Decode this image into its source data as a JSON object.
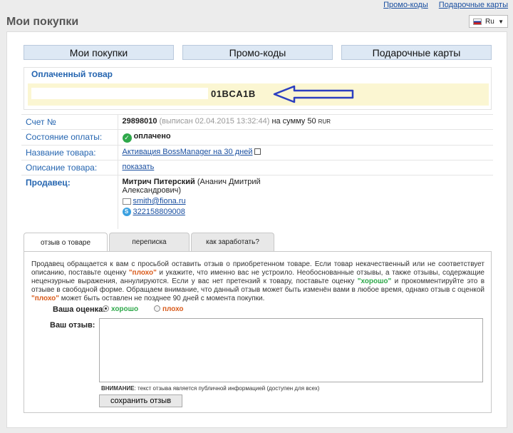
{
  "top_links": [
    "Промо-коды",
    "Подарочные карты"
  ],
  "page_title": "Мои покупки",
  "language": {
    "selected": "Ru"
  },
  "main_tabs": [
    "Мои покупки",
    "Промо-коды",
    "Подарочные карты"
  ],
  "paid_item": {
    "header": "Оплаченный товар",
    "code_suffix": "01BCA1B"
  },
  "info": {
    "invoice_label": "Счет №",
    "invoice_number": "29898010",
    "invoice_issued": "(выписан 02.04.2015 13:32:44)",
    "invoice_sum_prefix": "на сумму 50",
    "invoice_currency": "RUR",
    "payment_label": "Состояние оплаты:",
    "payment_status": "оплачено",
    "product_name_label": "Название товара:",
    "product_name": "Активация BossManager на 30 дней",
    "product_desc_label": "Описание товара:",
    "product_desc_link": "показать",
    "seller_label": "Продавец:",
    "seller_name": "Митрич Питерский",
    "seller_fullname": "(Ананич Дмитрий Александрович)",
    "seller_email": "smith@fiona.ru",
    "seller_skype": "322158809008"
  },
  "subtabs": [
    "отзыв о товаре",
    "переписка",
    "как заработать?"
  ],
  "review": {
    "desc_1": "Продавец обращается к вам с просьбой оставить отзыв о приобретенном товаре. Если товар некачественный или не соответствует описанию, поставьте оценку ",
    "bad_word": "\"плохо\"",
    "desc_2": " и укажите, что именно вас не устроило. Необоснованные отзывы, а также отзывы, содержащие нецензурные выражения, аннулируются. Если у вас нет претензий к товару, поставьте оценку ",
    "good_word": "\"хорошо\"",
    "desc_3": " и прокомментируйте это в отзыве в свободной форме. Обращаем внимание, что данный отзыв может быть изменён вами в любое время, однако отзыв с оценкой ",
    "bad_word_2": "\"плохо\"",
    "desc_4": " может быть оставлен не позднее 90 дней с момента покупки.",
    "rating_label": "Ваша оценка:",
    "rating_good": "хорошо",
    "rating_bad": "плохо",
    "review_label": "Ваш отзыв:",
    "review_value": "",
    "notice_bold": "ВНИМАНИЕ",
    "notice_text": ": текст отзыва является публичной информацией (доступен для всех)",
    "save_button": "сохранить отзыв"
  }
}
